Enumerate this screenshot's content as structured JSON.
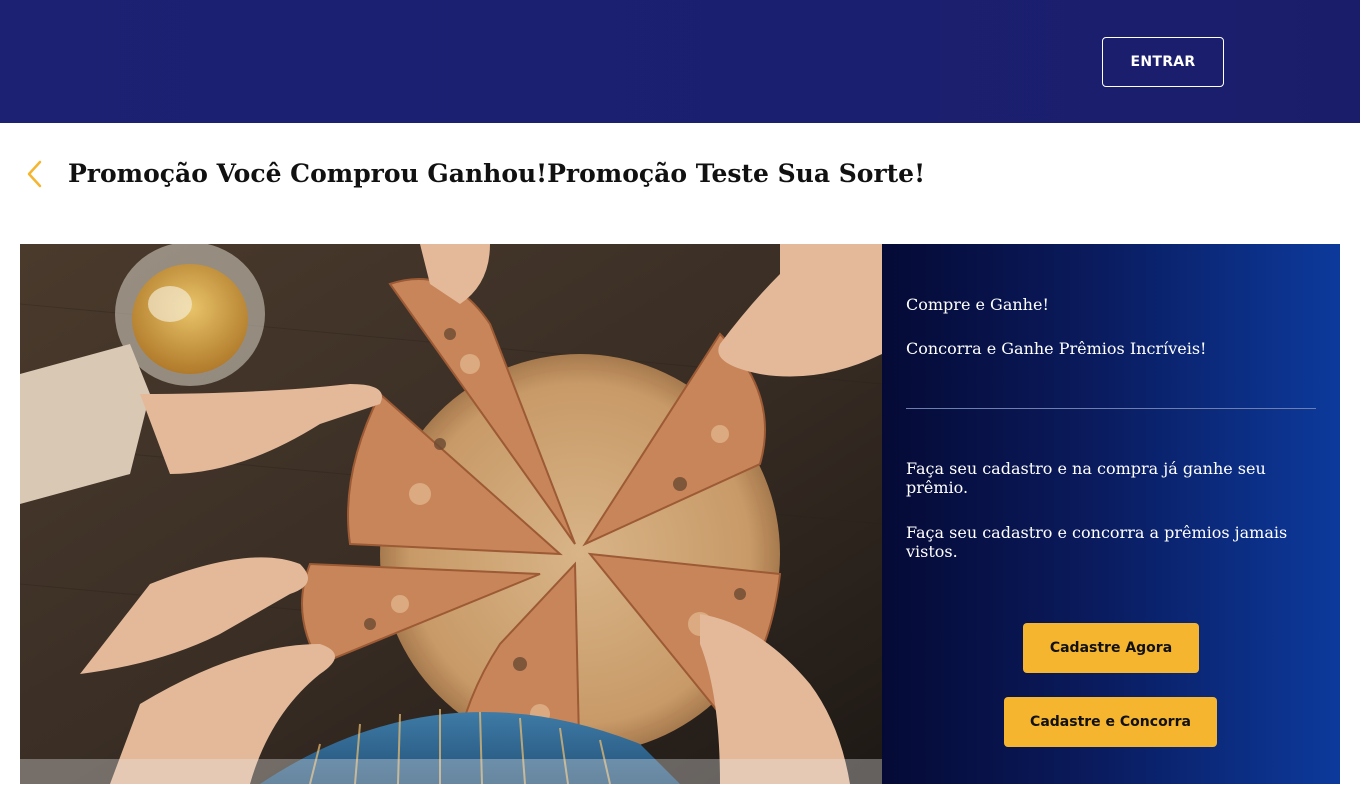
{
  "header": {
    "login_label": "ENTRAR"
  },
  "page": {
    "title": "Promoção Você Comprou Ganhou!Promoção Teste Sua Sorte!",
    "back_icon": "chevron-left-icon"
  },
  "hero": {
    "image_subject": "pizza-image",
    "panel": {
      "line1": "Compre e Ganhe!",
      "line2": "Concorra e Ganhe Prêmios Incríveis!",
      "line3": "Faça seu cadastro e na compra já ganhe seu prêmio.",
      "line4": "Faça seu cadastro e concorra a prêmios jamais vistos."
    },
    "buttons": {
      "register_now": "Cadastre Agora",
      "register_compete": "Cadastre e Concorra"
    }
  },
  "colors": {
    "header_bg": "#1c2173",
    "accent": "#f5b52f",
    "panel_gradient_start": "#050a35",
    "panel_gradient_end": "#0c3a9c"
  }
}
